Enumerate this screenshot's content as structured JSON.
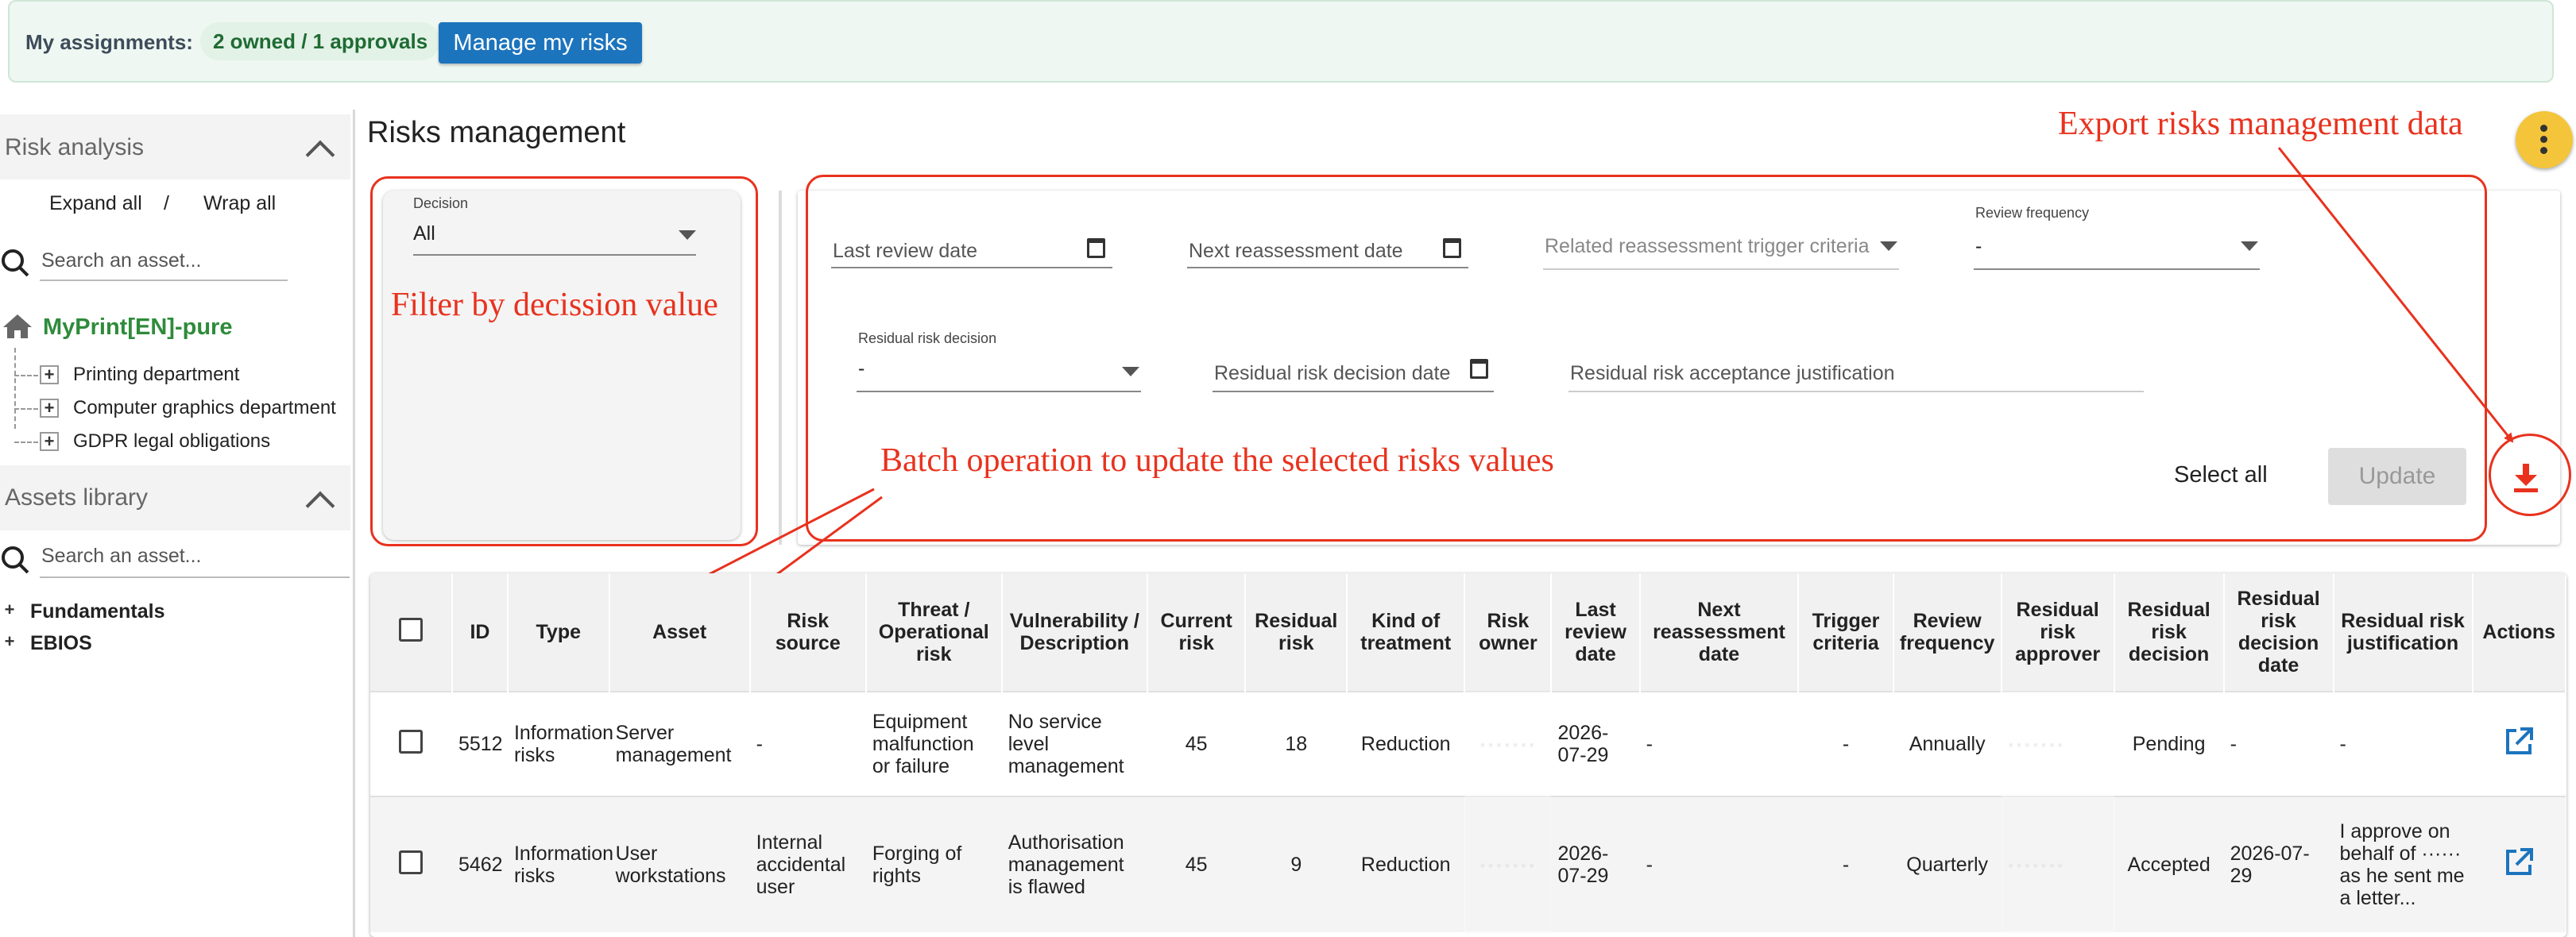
{
  "banner": {
    "assignments_label": "My assignments:",
    "assignments_badge": "2 owned / 1 approvals",
    "manage_button": "Manage my risks"
  },
  "sidebar": {
    "risk_analysis_title": "Risk analysis",
    "expand_all": "Expand all",
    "separator": "/",
    "wrap_all": "Wrap all",
    "search_placeholder": "Search an asset...",
    "root_item": "MyPrint[EN]-pure",
    "tree_items": [
      "Printing department",
      "Computer graphics department",
      "GDPR legal obligations"
    ],
    "assets_library_title": "Assets library",
    "library_search_placeholder": "Search an asset...",
    "library_items": [
      "Fundamentals",
      "EBIOS"
    ],
    "brand_color": "#2e8b3a"
  },
  "main": {
    "title": "Risks management"
  },
  "filter": {
    "decision_label": "Decision",
    "decision_value": "All"
  },
  "batch": {
    "last_review_date": "Last review date",
    "next_reassessment_date": "Next reassessment date",
    "trigger_criteria": "Related reassessment trigger criteria",
    "review_frequency_label": "Review frequency",
    "review_frequency_value": "-",
    "residual_decision_label": "Residual risk decision",
    "residual_decision_value": "-",
    "residual_decision_date": "Residual risk decision date",
    "acceptance_justification": "Residual risk acceptance justification",
    "select_all": "Select all",
    "update": "Update"
  },
  "annotations": {
    "export": "Export risks management data",
    "filter": "Filter by decission value",
    "batch": "Batch operation to update the selected risks values",
    "color": "#e8321e"
  },
  "table": {
    "headers": [
      "ID",
      "Type",
      "Asset",
      "Risk source",
      "Threat / Operational risk",
      "Vulnerability / Description",
      "Current risk",
      "Residual risk",
      "Kind of treatment",
      "Risk owner",
      "Last review date",
      "Next reassessment date",
      "Trigger criteria",
      "Review frequency",
      "Residual risk approver",
      "Residual risk decision",
      "Residual risk decision date",
      "Residual risk justification",
      "Actions"
    ],
    "rows": [
      {
        "id": "5512",
        "type": "Information risks",
        "asset": "Server management",
        "source": "-",
        "threat": "Equipment malfunction or failure",
        "vulnerability": "No service level management",
        "current": "45",
        "residual": "18",
        "treatment": "Reduction",
        "owner": "·······",
        "last_review": "2026-07-29",
        "next_reassessment": "-",
        "trigger": "-",
        "frequency": "Annually",
        "approver": "·······",
        "decision": "Pending",
        "decision_date": "-",
        "justification": "-"
      },
      {
        "id": "5462",
        "type": "Information risks",
        "asset": "User workstations",
        "source": "Internal accidental user",
        "threat": "Forging of rights",
        "vulnerability": "Authorisation management is flawed",
        "current": "45",
        "residual": "9",
        "treatment": "Reduction",
        "owner": "·······",
        "last_review": "2026-07-29",
        "next_reassessment": "-",
        "trigger": "-",
        "frequency": "Quarterly",
        "approver": "·······",
        "decision": "Accepted",
        "decision_date": "2026-07-29",
        "justification": "I approve on behalf of ······ as he sent me a letter..."
      }
    ]
  }
}
